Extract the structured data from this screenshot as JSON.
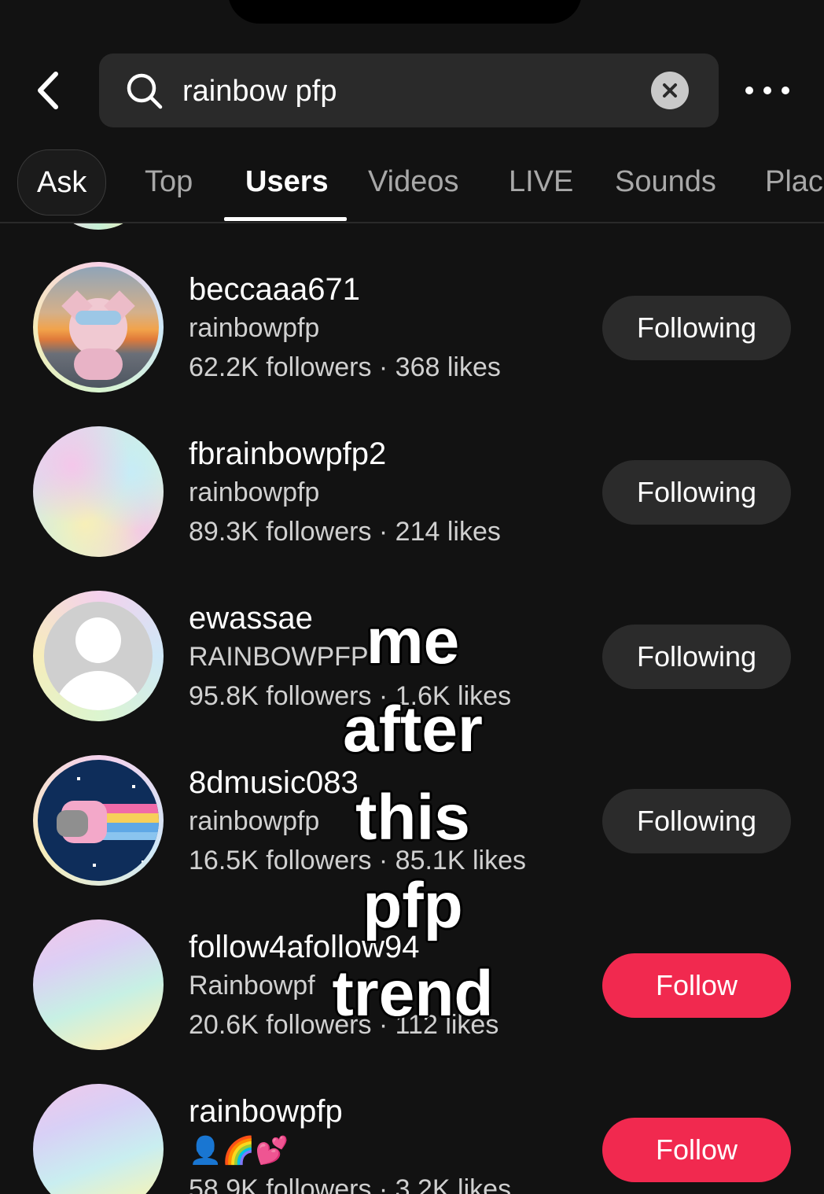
{
  "search": {
    "query": "rainbow pfp"
  },
  "tabs": [
    {
      "label": "Ask"
    },
    {
      "label": "Top"
    },
    {
      "label": "Users"
    },
    {
      "label": "Videos"
    },
    {
      "label": "LIVE"
    },
    {
      "label": "Sounds"
    },
    {
      "label": "Plac"
    }
  ],
  "users": [
    {
      "username": "beccaaa671",
      "bio": "rainbowpfp",
      "stats": "62.2K followers · 368 likes",
      "button": "Following"
    },
    {
      "username": "fbrainbowpfp2",
      "bio": "rainbowpfp",
      "stats": "89.3K followers · 214 likes",
      "button": "Following"
    },
    {
      "username": "ewassae",
      "bio": "RAINBOWPFP",
      "stats": "95.8K followers · 1.6K likes",
      "button": "Following"
    },
    {
      "username": "8dmusic083",
      "bio": "rainbowpfp",
      "stats": "16.5K followers · 85.1K likes",
      "button": "Following"
    },
    {
      "username": "follow4afollow94",
      "bio": "Rainbowpf",
      "stats": "20.6K followers · 112 likes",
      "button": "Follow"
    },
    {
      "username": "rainbowpfp",
      "bio": "👤🌈💕",
      "stats": "58.9K followers · 3.2K likes",
      "button": "Follow"
    }
  ],
  "overlay_caption": [
    "me",
    "after",
    "this",
    "pfp",
    "trend"
  ],
  "colors": {
    "follow_accent": "#f1294f",
    "following_bg": "#2b2b2b",
    "background": "#121212"
  }
}
